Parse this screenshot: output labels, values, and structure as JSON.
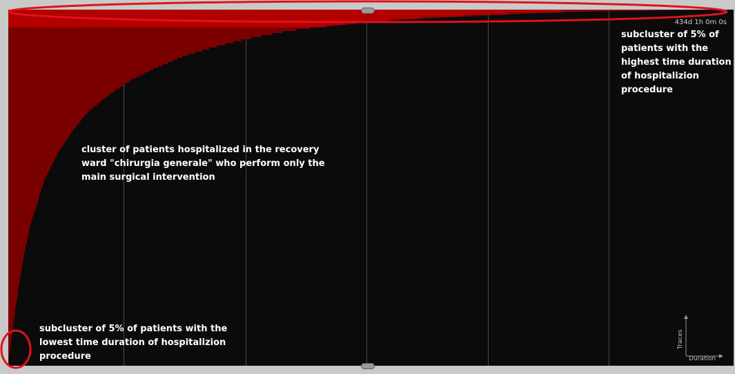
{
  "chart_data": {
    "type": "area",
    "title": "",
    "xlabel": "Duration",
    "ylabel": "Traces",
    "max_duration_label": "434d 1h 0m 0s",
    "color": "#7a0000",
    "highlight_color": "#e00000",
    "grid": true,
    "curve": {
      "x": [
        0,
        0.005,
        0.01,
        0.02,
        0.03,
        0.05,
        0.07,
        0.09,
        0.11,
        0.14,
        0.17,
        0.2,
        0.24,
        0.28,
        0.33,
        0.38,
        0.43,
        0.5,
        0.57,
        0.65,
        0.73,
        0.8,
        0.88,
        0.95,
        1.0
      ],
      "y": [
        0.005,
        0.08,
        0.16,
        0.29,
        0.39,
        0.52,
        0.6,
        0.66,
        0.71,
        0.76,
        0.8,
        0.83,
        0.865,
        0.89,
        0.915,
        0.935,
        0.95,
        0.965,
        0.975,
        0.983,
        0.99,
        0.995,
        0.998,
        0.999,
        1.0
      ]
    }
  },
  "annotations": {
    "top": "subcluster of 5% of\npatients with the\nhighest time duration\nof hospitalizion\nprocedure",
    "middle": "cluster of patients hospitalized in the recovery\nward \"chirurgia generale\" who perform only the\nmain surgical intervention",
    "bottom": "subcluster of 5% of patients with the\nlowest time duration of hospitalizion\nprocedure"
  },
  "colors": {
    "annotation_ring": "#e0121a",
    "grid": "#4a4a4a",
    "background": "#0b0b0c"
  }
}
